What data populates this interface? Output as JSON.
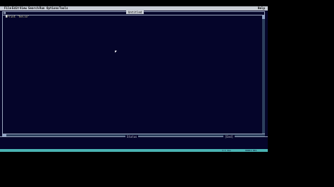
{
  "menubar": {
    "items": [
      "File",
      "Edit",
      "View",
      "Search",
      "Run",
      "Options",
      "Tools"
    ],
    "help": "Help"
  },
  "editor": {
    "title": "Untitled",
    "code_line": "Print \"hello\""
  },
  "status": {
    "title": "Status",
    "right": "[End]"
  },
  "bottombar": {
    "position": "1:1 Ins",
    "line": "00001:001"
  },
  "colors": {
    "background": "#05052a",
    "menubar": "#c8ccd4",
    "bottombar": "#4ab3b3"
  }
}
